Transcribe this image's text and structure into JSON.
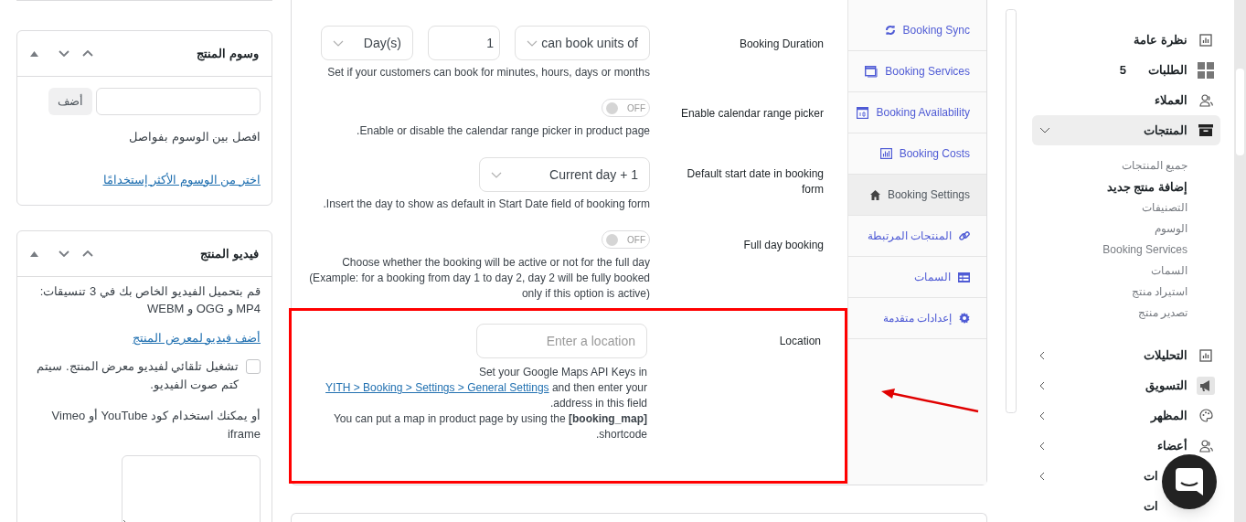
{
  "left_boxes": {
    "tags": {
      "title": "وسوم المنتج",
      "add_button": "أضف",
      "hint": "افصل بين الوسوم بفواصل",
      "link": "اختر من الوسوم الأكثر إستخدامًا"
    },
    "video": {
      "title": "فيديو المنتج",
      "text": "قم بتحميل الفيديو الخاص بك في 3 تنسيقات: MP4 و OGG و WEBM",
      "link": "أضف فيديو لمعرض المنتج",
      "autoplay": {
        "label": "تشغيل تلقائي لفيديو معرض المنتج. سيتم كتم صوت الفيديو.",
        "checked": false
      },
      "embed_text": "أو يمكنك استخدام كود YouTube أو Vimeo iframe"
    }
  },
  "form_rows": [
    {
      "kind": "duration",
      "label": "Booking Duration",
      "controls": [
        {
          "kind": "select",
          "value": "can book units of"
        },
        {
          "kind": "number",
          "value": "1"
        },
        {
          "kind": "select",
          "value": "Day(s)"
        }
      ],
      "help": "Set if your customers can book for minutes, hours, days or months"
    },
    {
      "kind": "toggle",
      "label": "Enable calendar range picker",
      "on": false,
      "state_text": "OFF",
      "help": "Enable or disable the calendar range picker in product page."
    },
    {
      "kind": "select",
      "label": "Default start date in booking form",
      "value": "Current day + 1",
      "help": "Insert the day to show as default in Start Date field of booking form."
    },
    {
      "kind": "toggle",
      "label": "Full day booking",
      "on": false,
      "state_text": "OFF",
      "help": "Choose whether the booking will be active or not for the full day (Example: for a booking from day 1 to day 2, day 2 will be fully booked only if this option is active)"
    },
    {
      "kind": "location",
      "label": "Location",
      "placeholder": "Enter a location",
      "help_before": "Set your Google Maps API Keys in",
      "help_link": "YITH > Booking > Settings > General Settings",
      "help_after": "and then enter your address in this field.",
      "note": "You can put a map in product page by using the **[booking_map]** shortcode.",
      "annotated": true
    }
  ],
  "tabs": [
    {
      "label": "Booking Sync",
      "selected": false
    },
    {
      "label": "Booking Services",
      "selected": false
    },
    {
      "label": "Booking Availability",
      "selected": false
    },
    {
      "label": "Booking Costs",
      "selected": false
    },
    {
      "label": "Booking Settings",
      "selected": true
    },
    {
      "label": "المنتجات المرتبطة",
      "selected": false
    },
    {
      "label": "السمات",
      "selected": false
    },
    {
      "label": "إعدادات متقدمة",
      "selected": false
    }
  ],
  "sidebar": {
    "items": [
      {
        "kind": "link",
        "label": "نظرة عامة"
      },
      {
        "kind": "link",
        "label": "الطلبات",
        "badge": "5"
      },
      {
        "kind": "link",
        "label": "العملاء"
      },
      {
        "kind": "group",
        "label": "المنتجات",
        "expanded": true,
        "selected": true,
        "children": [
          {
            "label": "جميع المنتجات",
            "selected": false
          },
          {
            "label": "إضافة منتج جديد",
            "selected": true
          },
          {
            "label": "التصنيفات",
            "selected": false
          },
          {
            "label": "الوسوم",
            "selected": false
          },
          {
            "label": "Booking Services",
            "selected": false
          },
          {
            "label": "السمات",
            "selected": false
          },
          {
            "label": "استيراد منتج",
            "selected": false
          },
          {
            "label": "تصدير منتج",
            "selected": false
          }
        ]
      },
      {
        "kind": "group",
        "label": "التحليلات",
        "expanded": false,
        "selected": false
      },
      {
        "kind": "group",
        "label": "التسويق",
        "expanded": false,
        "selected": false
      },
      {
        "kind": "group",
        "label": "المظهر",
        "expanded": false,
        "selected": false
      },
      {
        "kind": "group",
        "label": "أعضاء",
        "expanded": false,
        "selected": false
      },
      {
        "kind": "group",
        "label": "ات",
        "expanded": false,
        "selected": false
      },
      {
        "kind": "link",
        "label": "ات"
      }
    ]
  }
}
